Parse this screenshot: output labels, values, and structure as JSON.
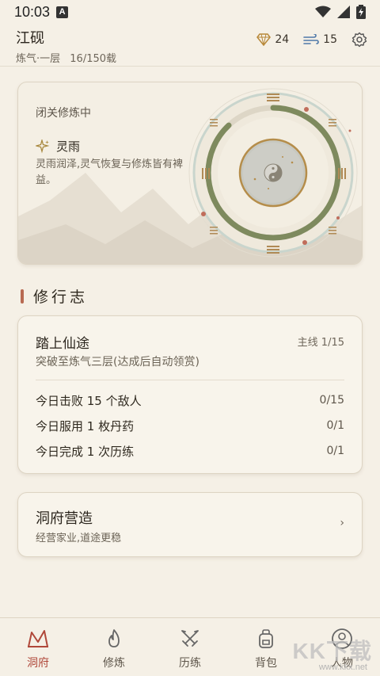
{
  "status_bar": {
    "time": "10:03",
    "notification_badge": "A",
    "icons": [
      "wifi-icon",
      "signal-icon",
      "battery-icon"
    ]
  },
  "header": {
    "name": "江砚",
    "realm": "炼气·一层",
    "age": "16/150载",
    "gems": "24",
    "energy": "15",
    "icons": [
      "gem-icon",
      "wind-icon",
      "settings-icon"
    ]
  },
  "retreat": {
    "status": "闭关修炼中",
    "weather_name": "灵雨",
    "weather_desc": "灵雨润泽,灵气恢复与修炼皆有裨益。",
    "progress": 0.88
  },
  "section": {
    "title": "修行志"
  },
  "quest": {
    "title": "踏上仙途",
    "tag": "主线 1/15",
    "desc": "突破至炼气三层(达成后自动领赏)",
    "tasks": [
      {
        "label": "今日击败 15 个敌人",
        "progress": "0/15"
      },
      {
        "label": "今日服用 1 枚丹药",
        "progress": "0/1"
      },
      {
        "label": "今日完成 1 次历练",
        "progress": "0/1"
      }
    ]
  },
  "build": {
    "title": "洞府营造",
    "subtitle": "经营家业,道途更稳",
    "chevron": "›"
  },
  "nav": {
    "items": [
      {
        "label": "洞府",
        "icon": "mountain-icon",
        "active": true
      },
      {
        "label": "修炼",
        "icon": "flame-icon",
        "active": false
      },
      {
        "label": "历练",
        "icon": "crossed-swords-icon",
        "active": false
      },
      {
        "label": "背包",
        "icon": "backpack-icon",
        "active": false
      },
      {
        "label": "人物",
        "icon": "person-icon",
        "active": false
      }
    ]
  },
  "watermark": {
    "main": "KK下载",
    "sub": "www.kkx.net"
  },
  "colors": {
    "accent": "#b0483a",
    "ring_progress": "#7e8a5e",
    "background": "#f5f0e6"
  }
}
